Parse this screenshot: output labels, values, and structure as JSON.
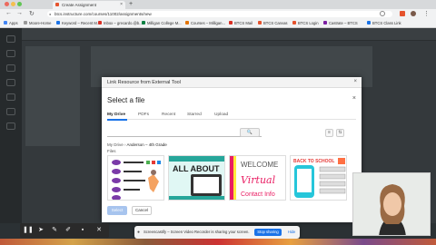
{
  "browser": {
    "tab_title": "Create Assignment",
    "url": "btcs.instructure.com/courses/11002/assignments/new",
    "bookmarks": [
      {
        "label": "Apps",
        "color": "#4285f4"
      },
      {
        "label": "Moore-Home",
        "color": "#999999"
      },
      {
        "label": "Keyword – Recent M...",
        "color": "#1a73e8"
      },
      {
        "label": "Inbox – grecardo.@b...",
        "color": "#d93025"
      },
      {
        "label": "Milligan College M...",
        "color": "#0b8043"
      },
      {
        "label": "Courses – Milligan...",
        "color": "#e37400"
      },
      {
        "label": "BTCS Mail",
        "color": "#d93025"
      },
      {
        "label": "BTCS Canvas",
        "color": "#e5532d"
      },
      {
        "label": "BTCS Login",
        "color": "#e5532d"
      },
      {
        "label": "Castrate – BTCS",
        "color": "#7b1fa2"
      },
      {
        "label": "BTCS Class Link",
        "color": "#1a73e8"
      }
    ]
  },
  "modal": {
    "title": "Link Resource from External Tool",
    "picker": {
      "title": "Select a file",
      "tabs": [
        "My Drive",
        "PDFs",
        "Recent",
        "Starred",
        "Upload"
      ],
      "active_tab": "My Drive",
      "search_icon": "search-icon",
      "breadcrumb_root": "My Drive",
      "breadcrumb_sep": "›",
      "breadcrumb_folder": "Anderson – 4th Grade",
      "files_label": "Files",
      "thumb_all_about": "ALL ABOUT",
      "thumb_welcome": "WELCOME",
      "thumb_virtual": "Virtual",
      "thumb_contact": "Contact Info",
      "thumb_back_to_school": "BACK TO SCHOOL",
      "select_label": "Select",
      "cancel_label": "Cancel"
    }
  },
  "recorder": {
    "share_text": "Screencastify – Screen Video Recorder is sharing your screen.",
    "stop_label": "Stop sharing",
    "hide_label": "Hide"
  }
}
